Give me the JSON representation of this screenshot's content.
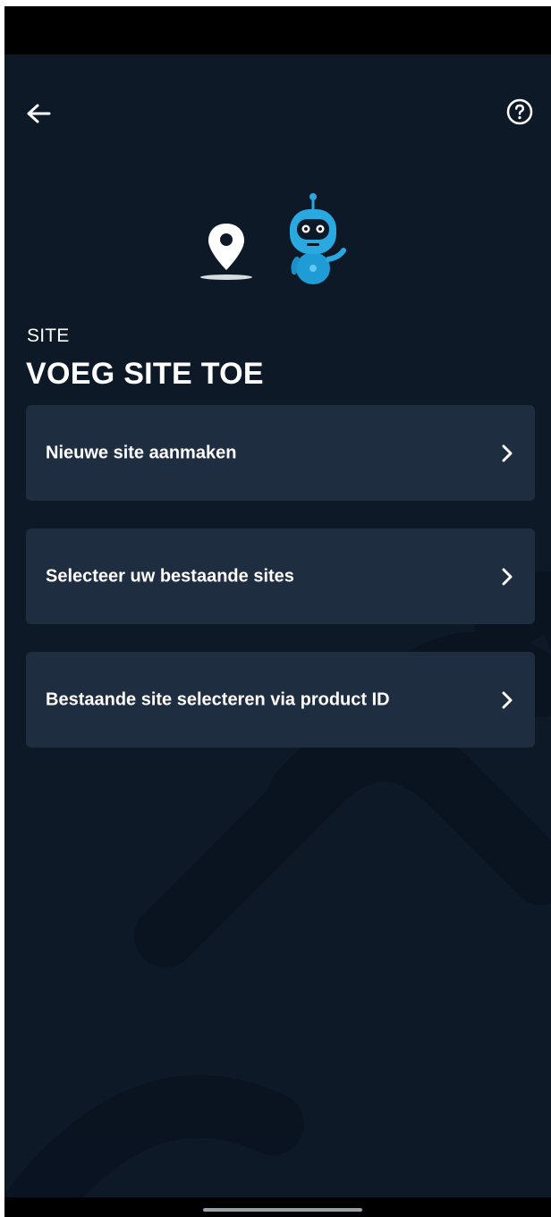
{
  "header": {
    "section_label": "SITE",
    "title": "VOEG SITE TOE",
    "back_icon": "arrow-left-icon",
    "help_icon": "question-circle-icon"
  },
  "illustration": {
    "icons": [
      "map-pin-icon",
      "robot-mascot-icon"
    ]
  },
  "options": [
    {
      "label": "Nieuwe site aanmaken",
      "icon": "chevron-right-icon"
    },
    {
      "label": "Selecteer uw bestaande sites",
      "icon": "chevron-right-icon"
    },
    {
      "label": "Bestaande site selecteren via product ID",
      "icon": "chevron-right-icon"
    }
  ],
  "colors": {
    "background": "#0e1928",
    "card": "#1f2d41",
    "text": "#ffffff",
    "robot_accent": "#2aa8e0"
  }
}
